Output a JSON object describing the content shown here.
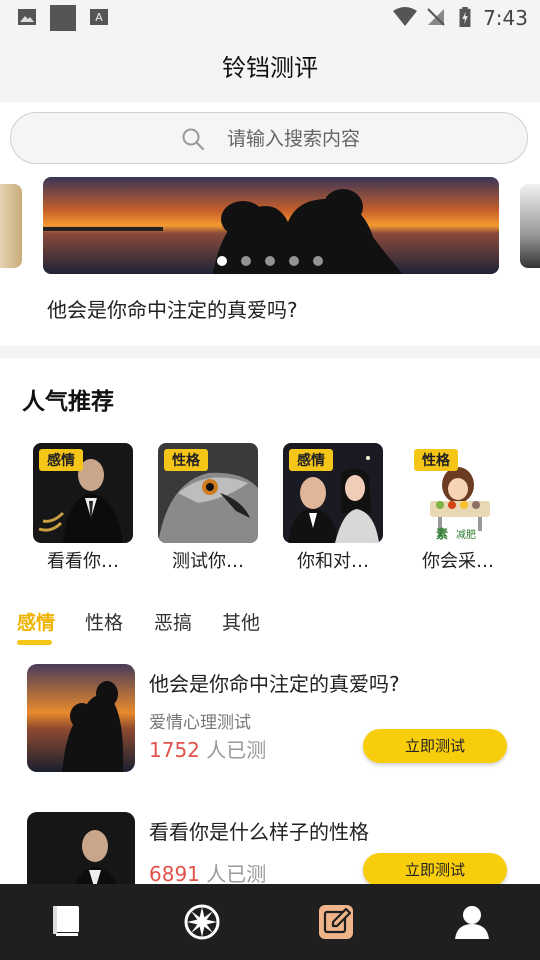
{
  "status_bar": {
    "time": "7:43"
  },
  "app_bar": {
    "title": "铃铛测评"
  },
  "search": {
    "placeholder": "请输入搜索内容"
  },
  "banner": {
    "caption": "他会是你命中注定的真爱吗?",
    "page_count": 5,
    "active_page": 1
  },
  "popular": {
    "title": "人气推荐",
    "items": [
      {
        "tag": "感情",
        "label": "看看你…"
      },
      {
        "tag": "性格",
        "label": "测试你…"
      },
      {
        "tag": "感情",
        "label": "你和对…"
      },
      {
        "tag": "性格",
        "label": "你会采…"
      }
    ]
  },
  "tabs": [
    {
      "label": "感情",
      "active": true
    },
    {
      "label": "性格",
      "active": false
    },
    {
      "label": "恶搞",
      "active": false
    },
    {
      "label": "其他",
      "active": false
    }
  ],
  "list": [
    {
      "title": "他会是你命中注定的真爱吗?",
      "subtitle": "爱情心理测试",
      "count": "1752",
      "count_suffix": "人已测",
      "button": "立即测试"
    },
    {
      "title": "看看你是什么样子的性格",
      "subtitle": "",
      "count": "6891",
      "count_suffix": "人已测",
      "button": "立即测试"
    }
  ],
  "bottom_nav": [
    {
      "icon": "book-icon"
    },
    {
      "icon": "wheel-icon"
    },
    {
      "icon": "edit-icon"
    },
    {
      "icon": "profile-icon"
    }
  ],
  "colors": {
    "accent": "#f8cd0c",
    "count_red": "#e0524a",
    "nav_bg": "#1f1f1f"
  }
}
